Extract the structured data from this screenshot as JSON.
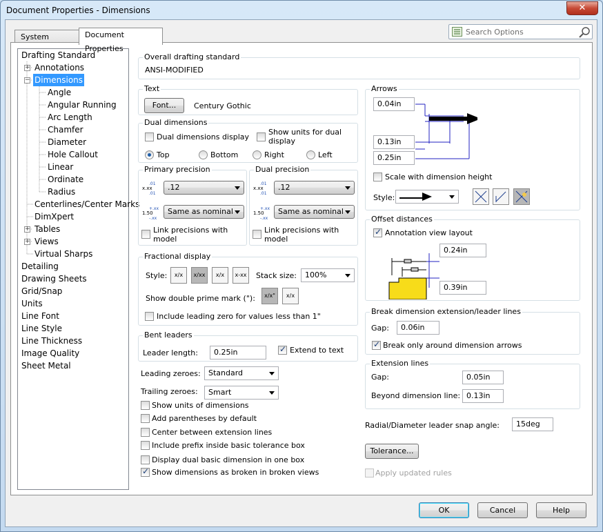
{
  "window": {
    "title": "Document Properties - Dimensions",
    "close": "✕"
  },
  "tabs": [
    "System Options",
    "Document Properties"
  ],
  "search": {
    "placeholder": "Search Options"
  },
  "tree": [
    {
      "label": "Drafting Standard"
    },
    {
      "label": "Annotations",
      "expander": "+"
    },
    {
      "label": "Dimensions",
      "expander": "−"
    },
    {
      "label": "Angle"
    },
    {
      "label": "Angular Running"
    },
    {
      "label": "Arc Length"
    },
    {
      "label": "Chamfer"
    },
    {
      "label": "Diameter"
    },
    {
      "label": "Hole Callout"
    },
    {
      "label": "Linear"
    },
    {
      "label": "Ordinate"
    },
    {
      "label": "Radius"
    },
    {
      "label": "Centerlines/Center Marks"
    },
    {
      "label": "DimXpert"
    },
    {
      "label": "Tables",
      "expander": "+"
    },
    {
      "label": "Views",
      "expander": "+"
    },
    {
      "label": "Virtual Sharps"
    },
    {
      "label": "Detailing"
    },
    {
      "label": "Drawing Sheets"
    },
    {
      "label": "Grid/Snap"
    },
    {
      "label": "Units"
    },
    {
      "label": "Line Font"
    },
    {
      "label": "Line Style"
    },
    {
      "label": "Line Thickness"
    },
    {
      "label": "Image Quality"
    },
    {
      "label": "Sheet Metal"
    }
  ],
  "overall": {
    "title": "Overall drafting standard",
    "value": "ANSI-MODIFIED"
  },
  "text": {
    "title": "Text",
    "font_button": "Font...",
    "font_name": "Century Gothic"
  },
  "dual": {
    "title": "Dual dimensions",
    "display": "Dual dimensions display",
    "show_units": "Show units for dual display",
    "top": "Top",
    "bottom": "Bottom",
    "right": "Right",
    "left": "Left"
  },
  "primary": {
    "title": "Primary precision",
    "value1": ".12",
    "value2": "Same as nominal",
    "link": "Link precisions with model",
    "icon1": ".01\nx.xx\n.01",
    "icon2": "1.50\n.xx"
  },
  "dualprec": {
    "title": "Dual precision",
    "value1": ".12",
    "value2": "Same as nominal",
    "link": "Link precisions with model"
  },
  "fractional": {
    "title": "Fractional display",
    "style": "Style:",
    "stack": "Stack size:",
    "stack_value": "100%",
    "double_prime": "Show double prime mark (\"):",
    "leading_zero": "Include leading zero for values less than 1\"",
    "icons": [
      "x/x",
      "x/xx",
      "x/x",
      "x-xx"
    ],
    "prime_icons": [
      "x/x\"",
      "x/x"
    ]
  },
  "bent": {
    "title": "Bent leaders",
    "leader_length": "Leader length:",
    "leader_value": "0.25in",
    "extend": "Extend to text"
  },
  "zeroes": {
    "leading": "Leading zeroes:",
    "leading_value": "Standard",
    "trailing": "Trailing zeroes:",
    "trailing_value": "Smart"
  },
  "options": [
    {
      "label": "Show units of dimensions",
      "checked": false
    },
    {
      "label": "Add parentheses by default",
      "checked": false
    },
    {
      "label": "Center between extension lines",
      "checked": false
    },
    {
      "label": "Include prefix inside basic tolerance box",
      "checked": false
    },
    {
      "label": "Display dual basic dimension in one box",
      "checked": false
    },
    {
      "label": "Show dimensions as broken in broken views",
      "checked": true
    }
  ],
  "arrows": {
    "title": "Arrows",
    "v1": "0.04in",
    "v2": "0.13in",
    "v3": "0.25in",
    "scale": "Scale with dimension height",
    "style": "Style:"
  },
  "offset": {
    "title": "Offset distances",
    "annotation": "Annotation view layout",
    "v1": "0.24in",
    "v2": "0.39in"
  },
  "break": {
    "title": "Break dimension extension/leader lines",
    "gap": "Gap:",
    "gap_value": "0.06in",
    "around": "Break only around dimension arrows"
  },
  "ext": {
    "title": "Extension lines",
    "gap": "Gap:",
    "gap_value": "0.05in",
    "beyond": "Beyond dimension line:",
    "beyond_value": "0.13in"
  },
  "radial": {
    "label": "Radial/Diameter leader snap angle:",
    "value": "15deg"
  },
  "tolerance": "Tolerance...",
  "apply": "Apply updated rules",
  "footer": {
    "ok": "OK",
    "cancel": "Cancel",
    "help": "Help"
  }
}
